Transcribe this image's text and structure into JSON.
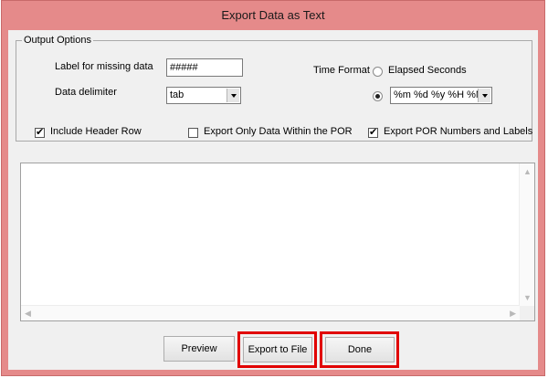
{
  "window": {
    "title": "Export Data as Text"
  },
  "output_options": {
    "legend": "Output Options",
    "missing_label": "Label for missing data",
    "missing_value": "#####",
    "delimiter_label": "Data delimiter",
    "delimiter_value": "tab",
    "time_format_label": "Time Format",
    "time_elapsed_label": "Elapsed Seconds",
    "time_format_value": "%m %d %y %H %M",
    "include_header_label": "Include Header Row",
    "include_header_checked": true,
    "only_por_label": "Export Only Data Within the POR",
    "only_por_checked": false,
    "por_numbers_label": "Export POR Numbers and Labels",
    "por_numbers_checked": true
  },
  "buttons": {
    "preview": "Preview",
    "export": "Export to File",
    "done": "Done"
  },
  "colors": {
    "title_bar": "#e58a8a",
    "highlight": "#e10000"
  }
}
